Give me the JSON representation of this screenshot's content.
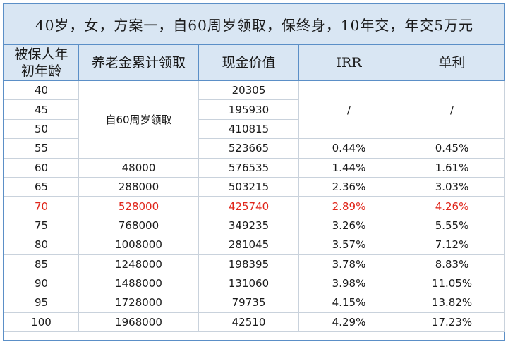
{
  "title": "40岁，女，方案一，自60周岁领取，保终身，10年交，年交5万元",
  "headers": {
    "age": "被保人年初年龄",
    "age_line1": "被保人年",
    "age_line2": "初年龄",
    "pension": "养老金累计领取",
    "cash": "现金价值",
    "irr": "IRR",
    "simple": "单利"
  },
  "merged": {
    "pension_note": "自60周岁领取",
    "irr_slash": "/",
    "simple_slash": "/"
  },
  "rows": [
    {
      "age": "40",
      "pension": "",
      "cash": "20305",
      "irr": "",
      "simple": ""
    },
    {
      "age": "45",
      "pension": "",
      "cash": "195930",
      "irr": "",
      "simple": ""
    },
    {
      "age": "50",
      "pension": "",
      "cash": "410815",
      "irr": "",
      "simple": ""
    },
    {
      "age": "55",
      "pension": "",
      "cash": "523665",
      "irr": "0.44%",
      "simple": "0.45%"
    },
    {
      "age": "60",
      "pension": "48000",
      "cash": "576535",
      "irr": "1.44%",
      "simple": "1.61%"
    },
    {
      "age": "65",
      "pension": "288000",
      "cash": "503215",
      "irr": "2.36%",
      "simple": "3.03%"
    },
    {
      "age": "70",
      "pension": "528000",
      "cash": "425740",
      "irr": "2.89%",
      "simple": "4.26%"
    },
    {
      "age": "75",
      "pension": "768000",
      "cash": "349235",
      "irr": "3.26%",
      "simple": "5.55%"
    },
    {
      "age": "80",
      "pension": "1008000",
      "cash": "281045",
      "irr": "3.57%",
      "simple": "7.12%"
    },
    {
      "age": "85",
      "pension": "1248000",
      "cash": "198395",
      "irr": "3.78%",
      "simple": "8.83%"
    },
    {
      "age": "90",
      "pension": "1488000",
      "cash": "131060",
      "irr": "3.98%",
      "simple": "11.05%"
    },
    {
      "age": "95",
      "pension": "1728000",
      "cash": "79735",
      "irr": "4.15%",
      "simple": "13.82%"
    },
    {
      "age": "100",
      "pension": "1968000",
      "cash": "42510",
      "irr": "4.29%",
      "simple": "17.23%"
    }
  ],
  "highlight_color": "#e0261b",
  "header_bg": "#d9e6f3"
}
